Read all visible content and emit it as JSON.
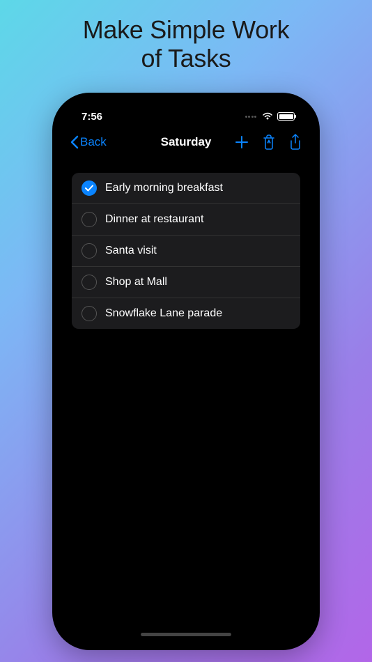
{
  "headline": {
    "line1": "Make Simple Work",
    "line2": "of Tasks"
  },
  "status": {
    "time": "7:56"
  },
  "nav": {
    "back_label": "Back",
    "title": "Saturday"
  },
  "tasks": [
    {
      "label": "Early morning breakfast",
      "checked": true
    },
    {
      "label": "Dinner at restaurant",
      "checked": false
    },
    {
      "label": "Santa visit",
      "checked": false
    },
    {
      "label": "Shop at Mall",
      "checked": false
    },
    {
      "label": "Snowflake Lane parade",
      "checked": false
    }
  ],
  "colors": {
    "accent": "#0a84ff"
  }
}
